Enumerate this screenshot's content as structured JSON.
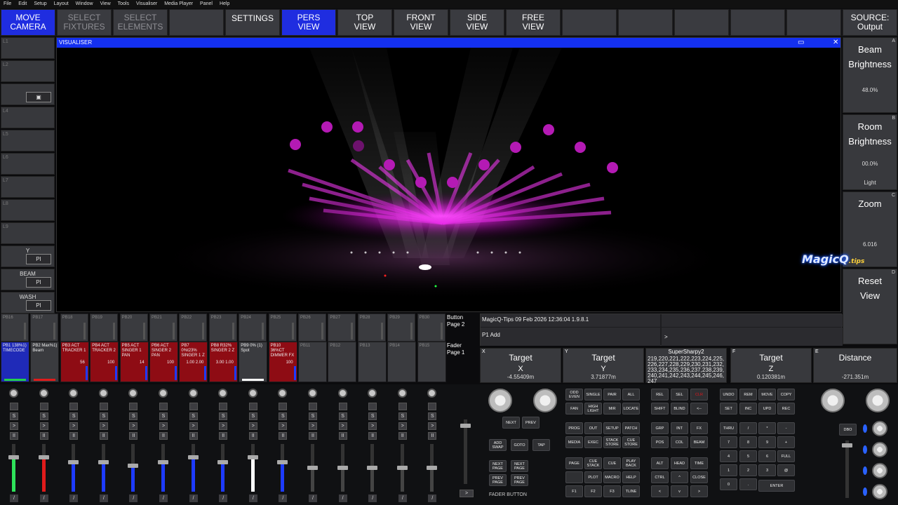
{
  "menu": [
    "File",
    "Edit",
    "Setup",
    "Layout",
    "Window",
    "View",
    "Tools",
    "Visualiser",
    "Media Player",
    "Panel",
    "Help"
  ],
  "top_buttons": [
    {
      "l1": "MOVE",
      "l2": "CAMERA",
      "state": "active"
    },
    {
      "l1": "SELECT",
      "l2": "FIXTURES",
      "state": "dim"
    },
    {
      "l1": "SELECT",
      "l2": "ELEMENTS",
      "state": "dim"
    },
    {
      "l1": "",
      "l2": "",
      "state": "normal"
    },
    {
      "l1": "SETTINGS",
      "l2": "",
      "state": "head"
    },
    {
      "l1": "PERS",
      "l2": "VIEW",
      "state": "active"
    },
    {
      "l1": "TOP",
      "l2": "VIEW",
      "state": "normal"
    },
    {
      "l1": "FRONT",
      "l2": "VIEW",
      "state": "normal"
    },
    {
      "l1": "SIDE",
      "l2": "VIEW",
      "state": "normal"
    },
    {
      "l1": "FREE",
      "l2": "VIEW",
      "state": "normal"
    },
    {
      "l1": "",
      "l2": "",
      "state": "normal"
    },
    {
      "l1": "",
      "l2": "",
      "state": "normal"
    },
    {
      "l1": "",
      "l2": "",
      "state": "normal"
    },
    {
      "l1": "",
      "l2": "",
      "state": "normal"
    },
    {
      "l1": "",
      "l2": "",
      "state": "normal"
    },
    {
      "l1": "SOURCE:",
      "l2": "Output",
      "state": "normal"
    }
  ],
  "left_buttons": [
    {
      "id": "L1",
      "label": "",
      "box": ""
    },
    {
      "id": "L2",
      "label": "",
      "box": ""
    },
    {
      "id": "",
      "label": "",
      "box": "▣"
    },
    {
      "id": "L4",
      "label": "",
      "box": ""
    },
    {
      "id": "L5",
      "label": "",
      "box": ""
    },
    {
      "id": "L6",
      "label": "",
      "box": ""
    },
    {
      "id": "L7",
      "label": "",
      "box": ""
    },
    {
      "id": "L8",
      "label": "",
      "box": ""
    },
    {
      "id": "L9",
      "label": "",
      "box": ""
    },
    {
      "id": "",
      "label": "Y",
      "box": "PI"
    },
    {
      "id": "",
      "label": "BEAM",
      "box": "PI"
    },
    {
      "id": "",
      "label": "WASH",
      "box": "PI"
    }
  ],
  "visualiser": {
    "title": "VISUALISER",
    "restore": "▭",
    "close": "✕"
  },
  "right_panel": {
    "beam": {
      "corner": "A",
      "title1": "Beam",
      "title2": "Brightness",
      "value": "48.0%"
    },
    "room": {
      "corner": "B",
      "title1": "Room",
      "title2": "Brightness",
      "value": "00.0%",
      "sub": "Light"
    },
    "zoom": {
      "corner": "C",
      "title1": "Zoom",
      "value": "6.016"
    },
    "reset": {
      "corner": "D",
      "title1": "Reset",
      "title2": "View"
    }
  },
  "logo": {
    "main": "MagicQ",
    "sub": ".tips"
  },
  "pb_row1": [
    "PB16",
    "PB17",
    "PB18",
    "PB19",
    "PB20",
    "PB21",
    "PB22",
    "PB23",
    "PB24",
    "PB25",
    "PB26",
    "PB27",
    "PB28",
    "PB29",
    "PB30"
  ],
  "page_labels": {
    "button": "Button\nPage 2",
    "fader": "Fader\nPage 1"
  },
  "pb_row2": [
    {
      "head": "PB1 138%1)",
      "sub": "TIMECODE",
      "val": "",
      "style": "blue",
      "strip": "#22d14a"
    },
    {
      "head": "PB2 Max%1)",
      "sub": "Beam",
      "val": "",
      "style": "normal",
      "strip": "#e01b1b"
    },
    {
      "head": "PB3 ACT",
      "sub": "TRACKER 1",
      "val": "56",
      "style": "red",
      "strip": ""
    },
    {
      "head": "PB4 ACT",
      "sub": "TRACKER 2",
      "val": "100",
      "style": "red",
      "strip": ""
    },
    {
      "head": "PB5 ACT",
      "sub": "SINGER 1 PAN",
      "val": "14",
      "style": "red",
      "strip": ""
    },
    {
      "head": "PB6 ACT",
      "sub": "SINGER 2 PAN",
      "val": "100",
      "style": "red",
      "strip": ""
    },
    {
      "head": "PB7 0%t23%",
      "sub": "SINGER 1 Z",
      "val": "1.00 2.00",
      "style": "red",
      "strip": ""
    },
    {
      "head": "PB8 R32%",
      "sub": "SINGER 2 Z",
      "val": "3.00 1.00",
      "style": "red",
      "strip": ""
    },
    {
      "head": "PB9 0% (1)",
      "sub": "Spot",
      "val": "",
      "style": "normal",
      "strip": "#ffffff"
    },
    {
      "head": "PB10 36%CT",
      "sub": "DIMMER FX",
      "val": "100",
      "style": "red",
      "strip": ""
    },
    {
      "head": "PB11",
      "sub": "",
      "val": "",
      "style": "dim",
      "strip": ""
    },
    {
      "head": "PB12",
      "sub": "",
      "val": "",
      "style": "dim",
      "strip": ""
    },
    {
      "head": "PB13",
      "sub": "",
      "val": "",
      "style": "dim",
      "strip": ""
    },
    {
      "head": "PB14",
      "sub": "",
      "val": "",
      "style": "dim",
      "strip": ""
    },
    {
      "head": "PB15",
      "sub": "",
      "val": "",
      "style": "dim",
      "strip": ""
    }
  ],
  "status": {
    "line1": "MagicQ-Tips 09 Feb 2026 12:36:04 1.9.8.1",
    "line2": "P1  Add",
    "prompt": ">"
  },
  "encoders": [
    {
      "corner": "X",
      "title1": "Target",
      "title2": "X",
      "value": "-4.55409m"
    },
    {
      "corner": "Y",
      "title1": "Target",
      "title2": "Y",
      "value": "3.71877m"
    },
    {
      "corner": "",
      "title1": "SuperSharpy2",
      "title2": "219,220,221,222,223,224,225,226,227,228,229,230,231,232,233,234,235,236,237,238,239,240,241,242,243,244,245,246,247",
      "value": ""
    },
    {
      "corner": "F",
      "title1": "Target",
      "title2": "Z",
      "value": "0.120381m"
    },
    {
      "corner": "E",
      "title1": "Distance",
      "title2": "",
      "value": "-271.351m"
    }
  ],
  "faders": [
    {
      "color": "#2ee35a",
      "level": 0.72
    },
    {
      "color": "#e01b1b",
      "level": 0.72
    },
    {
      "color": "#1d3bff",
      "level": 0.62
    },
    {
      "color": "#1d3bff",
      "level": 0.62
    },
    {
      "color": "#1d3bff",
      "level": 0.55
    },
    {
      "color": "#1d3bff",
      "level": 0.62
    },
    {
      "color": "#1d3bff",
      "level": 0.72
    },
    {
      "color": "#1d3bff",
      "level": 0.62
    },
    {
      "color": "#ffffff",
      "level": 0.72
    },
    {
      "color": "#1d3bff",
      "level": 0.62
    },
    {
      "color": "#444444",
      "level": 0.5
    },
    {
      "color": "#444444",
      "level": 0.5
    },
    {
      "color": "#444444",
      "level": 0.5
    },
    {
      "color": "#444444",
      "level": 0.5
    },
    {
      "color": "#444444",
      "level": 0.5
    }
  ],
  "fader_buttons": {
    "s": "S",
    "go": ">",
    "pause": "II",
    "slash": "/"
  },
  "console_labels": {
    "fader_button": "FADER  BUTTON"
  },
  "keys": {
    "next": "NEXT",
    "prev": "PREV",
    "add_swap": "ADD SWAP",
    "goto": "GOTO",
    "tap": "TAP",
    "next_page": "NEXT PAGE",
    "prev_page": "PREV PAGE",
    "group1": [
      "ODD EVEN",
      "SINGLE",
      "PAIR",
      "ALL",
      "FAN",
      "HIGH LIGHT",
      "MIR",
      "LOCATE"
    ],
    "group2": [
      "PROG",
      "OUT",
      "SETUP",
      "PATCH",
      "MEDIA",
      "EXEC",
      "STACK STORE",
      "CUE STORE"
    ],
    "group3": [
      "PAGE",
      "CUE STACK",
      "CUE",
      "PLAY BACK",
      "",
      "PLOT",
      "MACRO",
      "HELP",
      "F1",
      "F2",
      "F3",
      "TLINE"
    ],
    "group4": [
      "REL",
      "SEL",
      "CLR",
      "SHIFT",
      "BLIND",
      "<--"
    ],
    "group5": [
      "GRP",
      "INT",
      "FX",
      "POS",
      "COL",
      "BEAM"
    ],
    "group6": [
      "ALT",
      "HEAD",
      "TIME",
      "CTRL",
      "^",
      "CLOSE",
      "<",
      "v",
      ">"
    ],
    "group7": [
      "UNDO",
      "REM",
      "MOVE",
      "COPY",
      "SET",
      "INC",
      "UPD",
      "REC"
    ],
    "keypad": [
      "THRU",
      "/",
      "*",
      "-",
      "7",
      "8",
      "9",
      "+",
      "4",
      "5",
      "6",
      "FULL",
      "1",
      "2",
      "3",
      "@",
      "0",
      ".",
      "ENTER"
    ],
    "dbo": "DBO"
  }
}
